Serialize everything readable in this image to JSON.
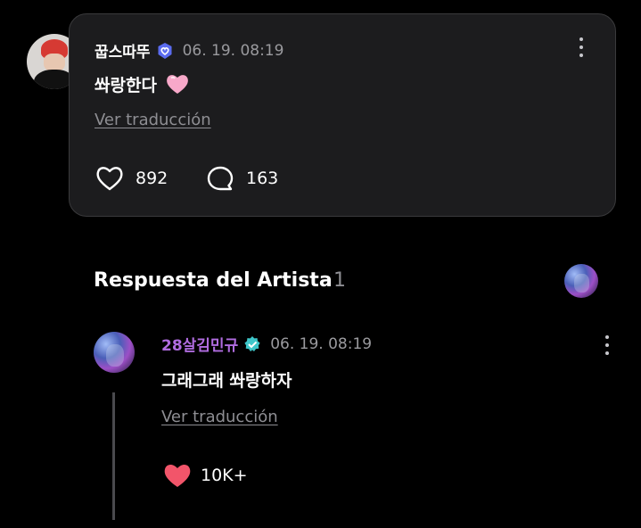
{
  "post": {
    "author": "꿉스따뚜",
    "timestamp": "06. 19. 08:19",
    "text": "쏴랑한다",
    "translate_link": "Ver traducción",
    "likes": "892",
    "comments": "163",
    "icons": {
      "verified": "fan-badge-icon",
      "more": "more-vertical-icon",
      "heart": "heart-outline-icon",
      "comment": "comment-bubble-icon",
      "emoji": "pink-heart-emoji"
    }
  },
  "artist_section": {
    "title": "Respuesta del Artista",
    "count": "1"
  },
  "reply": {
    "author": "28살김민규",
    "timestamp": "06. 19. 08:19",
    "text": "그래그래 쏴랑하자",
    "translate_link": "Ver traducción",
    "likes": "10K+",
    "icons": {
      "verified": "artist-verified-icon",
      "more": "more-vertical-icon",
      "heart": "heart-filled-icon"
    }
  },
  "colors": {
    "background": "#000000",
    "card": "#1c1c1e",
    "artist_name": "#b06ce0",
    "liked_heart": "#f2556a",
    "verified_badge": "#5b6cf0",
    "artist_badge": "#3ec6c9"
  }
}
